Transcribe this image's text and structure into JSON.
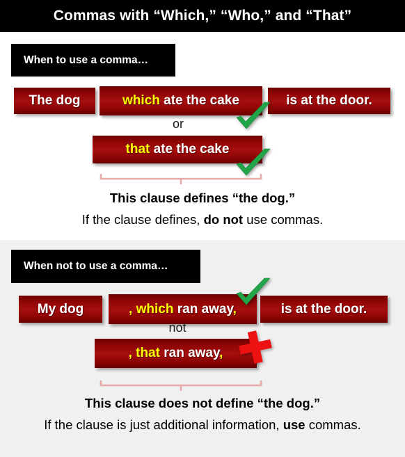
{
  "title": "Commas with “Which,” “Who,” and “That”",
  "sections": {
    "top": {
      "header": "When to use a comma…",
      "boxes": {
        "subject": "The dog",
        "clause_which": {
          "highlight": "which",
          "rest": " ate the cake"
        },
        "predicate": "is at the door.",
        "clause_that": {
          "highlight": "that",
          "rest": " ate the cake"
        }
      },
      "connector": "or",
      "caption_bold": "This clause defines “the dog.”",
      "caption_prefix": "If the clause defines, ",
      "caption_emphasis": "do not",
      "caption_suffix": " use commas.",
      "marks": [
        "check",
        "check"
      ]
    },
    "bottom": {
      "header": "When not to use a comma…",
      "boxes": {
        "subject": "My dog",
        "clause_which": {
          "comma_open": ", ",
          "highlight": "which",
          "rest": " ran away",
          "comma_close": ","
        },
        "predicate": "is at the door.",
        "clause_that": {
          "comma_open": ", ",
          "highlight": "that",
          "rest": " ran away",
          "comma_close": ","
        }
      },
      "connector": "not",
      "caption_bold": "This clause does not define “the dog.”",
      "caption_prefix": "If the clause is just additional information, ",
      "caption_emphasis": "use",
      "caption_suffix": " commas.",
      "marks": [
        "check",
        "cross"
      ]
    }
  },
  "colors": {
    "title_bar": "#000000",
    "box_red": "#8f0505",
    "highlight_yellow": "#ffff00",
    "check_green": "#22a548",
    "cross_red": "#ee1111",
    "bracket_pink": "#e8a9a9",
    "panel_top_bg": "#ffffff",
    "panel_bottom_bg": "#f0f0f0"
  },
  "icons": {
    "check": "check-mark-icon",
    "cross": "cross-mark-icon",
    "bracket": "bracket-icon"
  }
}
